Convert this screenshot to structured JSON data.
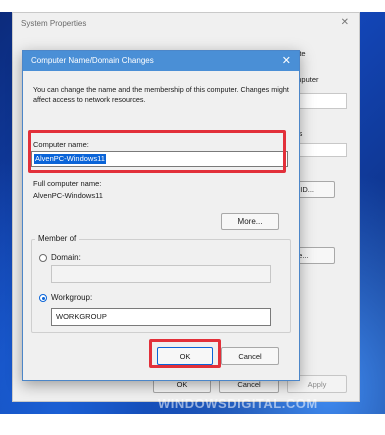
{
  "system_properties": {
    "title": "System Properties",
    "close_icon": "close-icon",
    "fragments": {
      "tab_partial": "nate",
      "line1_partial": "omputer",
      "line2_partial": "ry's",
      "id_button_partial": "e ID...",
      "change_button_partial": "ge..."
    },
    "buttons": {
      "ok": "OK",
      "cancel": "Cancel",
      "apply": "Apply"
    }
  },
  "dialog": {
    "title": "Computer Name/Domain Changes",
    "close_icon": "close-icon",
    "description": "You can change the name and the membership of this computer. Changes might affect access to network resources.",
    "computer_name_label": "Computer name:",
    "computer_name_value": "AlvenPC-Windows11",
    "full_computer_name_label": "Full computer name:",
    "full_computer_name_value": "AlvenPC-Windows11",
    "more_button": "More...",
    "member_of_label": "Member of",
    "domain_label": "Domain:",
    "domain_value": "",
    "workgroup_label": "Workgroup:",
    "workgroup_value": "WORKGROUP",
    "selected_membership": "Workgroup",
    "ok_button": "OK",
    "cancel_button": "Cancel"
  },
  "watermark": "WINDOWSDIGITAL.COM",
  "colors": {
    "highlight": "#e2303a",
    "titlebar": "#4a8fd6",
    "selection": "#0a64d8",
    "wallpaper": "#1346b8"
  }
}
